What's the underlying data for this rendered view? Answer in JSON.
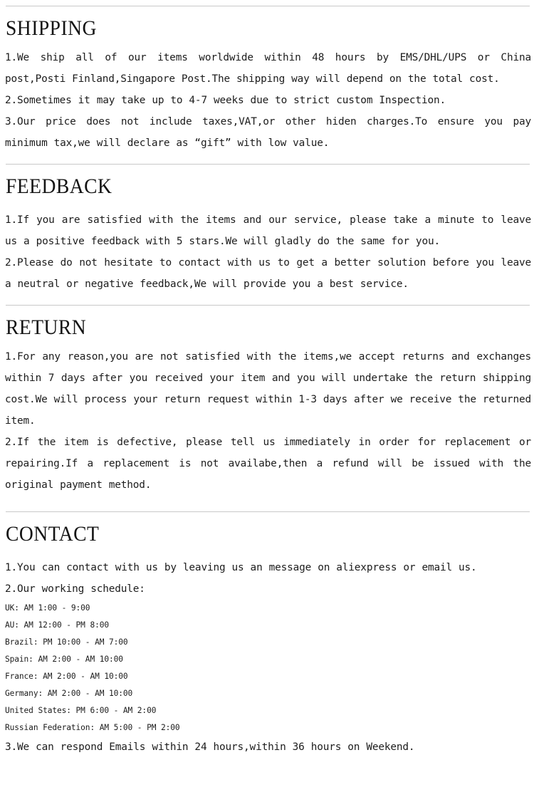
{
  "page": {
    "background_color": "#ffffff",
    "text_color": "#1c1c1c",
    "rule_color": "#c9c9c9"
  },
  "sections": [
    {
      "id": "shipping",
      "title": "SHIPPING",
      "paragraphs": [
        "1.We ship all of our items worldwide within 48 hours by EMS/DHL/UPS or China post,Posti Finland,Singapore Post.The shipping way will depend on the total cost.",
        "2.Sometimes it may take up to 4-7 weeks due to strict custom Inspection.",
        "3.Our price does not include taxes,VAT,or other hiden charges.To ensure you pay minimum tax,we will declare as “gift” with low value."
      ]
    },
    {
      "id": "feedback",
      "title": "FEEDBACK",
      "paragraphs": [
        "1.If you are satisfied with the items and our service, please take a minute to leave us a positive feedback with 5 stars.We will gladly do the same for you.",
        "2.Please do not hesitate to contact with us to get a better solution before you leave a neutral or negative feedback,We will provide you a best service."
      ]
    },
    {
      "id": "return",
      "title": "RETURN",
      "paragraphs": [
        "1.For any reason,you are not satisfied with the items,we accept returns and exchanges within 7 days after you received your item and you will undertake the return shipping cost.We will process your return request within 1-3 days after we receive the returned item.",
        "2.If the item is defective, please tell us immediately in order for replacement or repairing.If a replacement is not availabe,then a refund will be issued with the original payment method."
      ]
    },
    {
      "id": "contact",
      "title": "CONTACT",
      "paragraphs_before": [
        "1.You can contact with us by leaving us an message on aliexpress or email us.",
        "2.Our working schedule:"
      ],
      "schedule": [
        "UK: AM 1:00 - 9:00",
        "AU: AM 12:00 - PM 8:00",
        "Brazil: PM 10:00 - AM 7:00",
        "Spain: AM 2:00 - AM 10:00",
        "France: AM 2:00 - AM 10:00",
        "Germany: AM 2:00 - AM 10:00",
        "United States: PM 6:00 - AM 2:00",
        "Russian Federation: AM 5:00 - PM 2:00"
      ],
      "paragraphs_after": [
        "3.We can respond Emails within 24 hours,within 36 hours on Weekend."
      ]
    }
  ]
}
